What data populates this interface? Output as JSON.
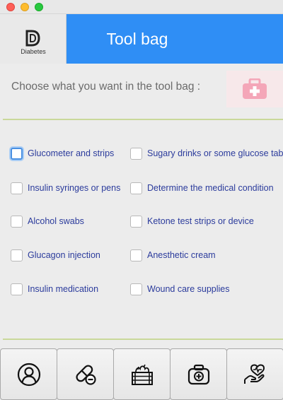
{
  "window": {
    "controls": [
      "close",
      "minimize",
      "maximize"
    ]
  },
  "header": {
    "logo_text": "Diabetes",
    "title": "Tool bag",
    "color": "#2f8ef5"
  },
  "prompt": {
    "text": "Choose what you want in the tool bag :",
    "icon": "first-aid-kit-icon"
  },
  "options": {
    "left": [
      {
        "label": "Glucometer and strips",
        "checked": false,
        "focused": true
      },
      {
        "label": "Insulin syringes or pens",
        "checked": false
      },
      {
        "label": "Alcohol swabs",
        "checked": false
      },
      {
        "label": "Glucagon injection",
        "checked": false
      },
      {
        "label": "Insulin medication",
        "checked": false
      }
    ],
    "right": [
      {
        "label": "Sugary drinks or some glucose tabl.",
        "checked": false
      },
      {
        "label": "Determine the medical condition",
        "checked": false
      },
      {
        "label": "Ketone test strips or device",
        "checked": false
      },
      {
        "label": "Anesthetic cream",
        "checked": false
      },
      {
        "label": "Wound care supplies",
        "checked": false
      }
    ]
  },
  "bottom_nav": [
    {
      "icon": "user-profile-icon"
    },
    {
      "icon": "pill-icon"
    },
    {
      "icon": "food-crate-icon"
    },
    {
      "icon": "medical-kit-icon"
    },
    {
      "icon": "heart-hand-icon"
    }
  ]
}
